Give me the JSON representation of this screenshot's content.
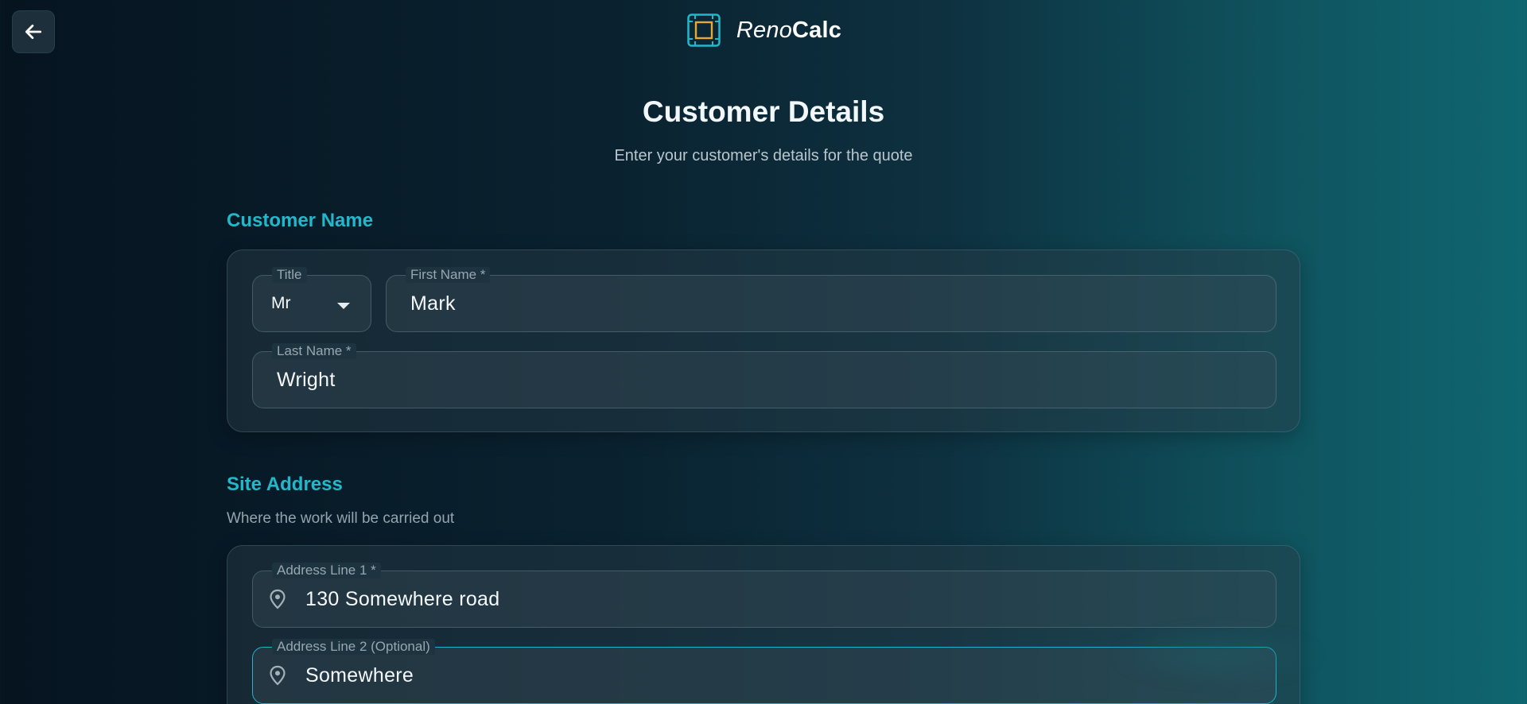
{
  "header": {
    "brand_part1": "Reno",
    "brand_part2": "Calc"
  },
  "page": {
    "title": "Customer Details",
    "subtitle": "Enter your customer's details for the quote"
  },
  "customer_name": {
    "section_title": "Customer Name",
    "title_field": {
      "label": "Title",
      "value": "Mr"
    },
    "first_name": {
      "label": "First Name *",
      "value": "Mark"
    },
    "last_name": {
      "label": "Last Name *",
      "value": "Wright"
    }
  },
  "site_address": {
    "section_title": "Site Address",
    "description": "Where the work will be carried out",
    "address_line_1": {
      "label": "Address Line 1 *",
      "value": "130 Somewhere road"
    },
    "address_line_2": {
      "label": "Address Line 2 (Optional)",
      "value": "Somewhere"
    }
  },
  "icons": {
    "back": "arrow-left-icon",
    "logo": "frame-logo-icon",
    "dropdown": "chevron-down-icon",
    "location": "map-pin-icon"
  },
  "colors": {
    "accent": "#22b8cc",
    "logo_square": "#e5a93a",
    "background_dark": "#061420",
    "background_teal": "#0f6670"
  }
}
